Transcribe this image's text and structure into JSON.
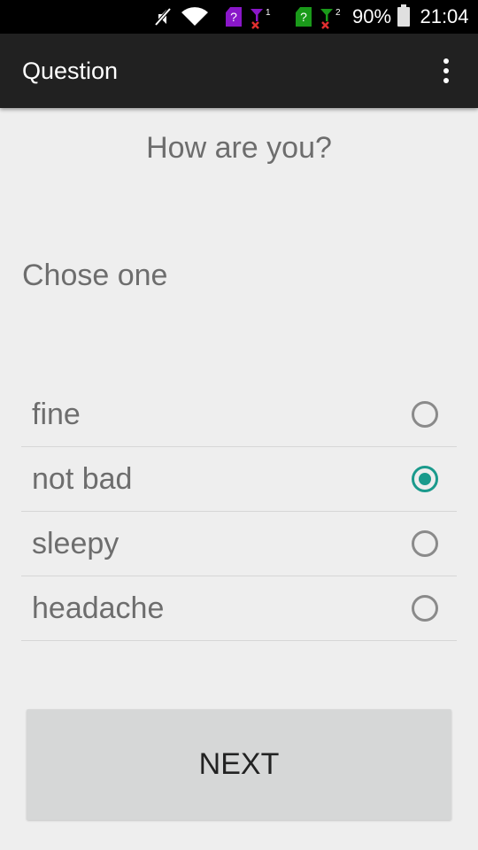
{
  "status_bar": {
    "icons": [
      "mute-icon",
      "wifi-icon",
      "sim1-icon",
      "signal-1-icon",
      "sim2-icon",
      "signal-2-icon",
      "battery-icon"
    ],
    "sim1_label": "?",
    "sim2_label": "?",
    "signal1_index": "1",
    "signal2_index": "2",
    "battery": "90%",
    "time": "21:04",
    "colors": {
      "sim1": "#8a17c9",
      "sim2": "#1a9a1a",
      "signal1": "#8a17c9",
      "signal2": "#1a9a1a",
      "no_signal_mark": "#e03030"
    }
  },
  "app_bar": {
    "title": "Question",
    "overflow_icon": "more-vertical-icon"
  },
  "question": {
    "title": "How are you?",
    "instruction": "Chose one",
    "options": [
      {
        "label": "fine",
        "selected": false
      },
      {
        "label": "not bad",
        "selected": true
      },
      {
        "label": "sleepy",
        "selected": false
      },
      {
        "label": "headache",
        "selected": false
      }
    ]
  },
  "actions": {
    "next_label": "NEXT"
  },
  "colors": {
    "background": "#eeeeee",
    "app_bar": "#212121",
    "accent": "#1a9a8c",
    "text_secondary": "#6d6d6d",
    "button": "#d6d7d7"
  }
}
